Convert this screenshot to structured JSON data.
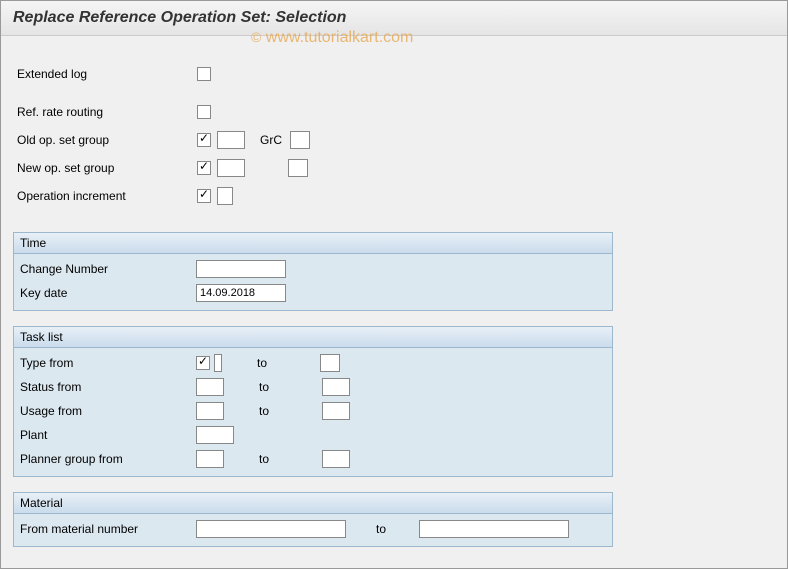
{
  "header": {
    "title": "Replace Reference Operation Set: Selection"
  },
  "watermark": {
    "text": "www.tutorialkart.com",
    "copyright": "©"
  },
  "top": {
    "extended_log_label": "Extended log",
    "ref_rate_routing_label": "Ref. rate routing",
    "old_op_set_group_label": "Old op. set group",
    "grc_label": "GrC",
    "new_op_set_group_label": "New op. set group",
    "operation_increment_label": "Operation increment",
    "old_op_set_group_value": "",
    "new_op_set_group_value": "",
    "operation_increment_value": "",
    "grc_value": "",
    "grc2_value": ""
  },
  "time": {
    "title": "Time",
    "change_number_label": "Change Number",
    "change_number_value": "",
    "key_date_label": "Key date",
    "key_date_value": "14.09.2018"
  },
  "tasklist": {
    "title": "Task list",
    "type_from_label": "Type from",
    "status_from_label": "Status from",
    "usage_from_label": "Usage from",
    "plant_label": "Plant",
    "planner_group_from_label": "Planner group from",
    "to_label": "to",
    "type_from_value": "",
    "type_to_value": "",
    "status_from_value": "",
    "status_to_value": "",
    "usage_from_value": "",
    "usage_to_value": "",
    "plant_value": "",
    "planner_group_from_value": "",
    "planner_group_to_value": ""
  },
  "material": {
    "title": "Material",
    "from_material_label": "From material number",
    "to_label": "to",
    "from_value": "",
    "to_value": ""
  }
}
